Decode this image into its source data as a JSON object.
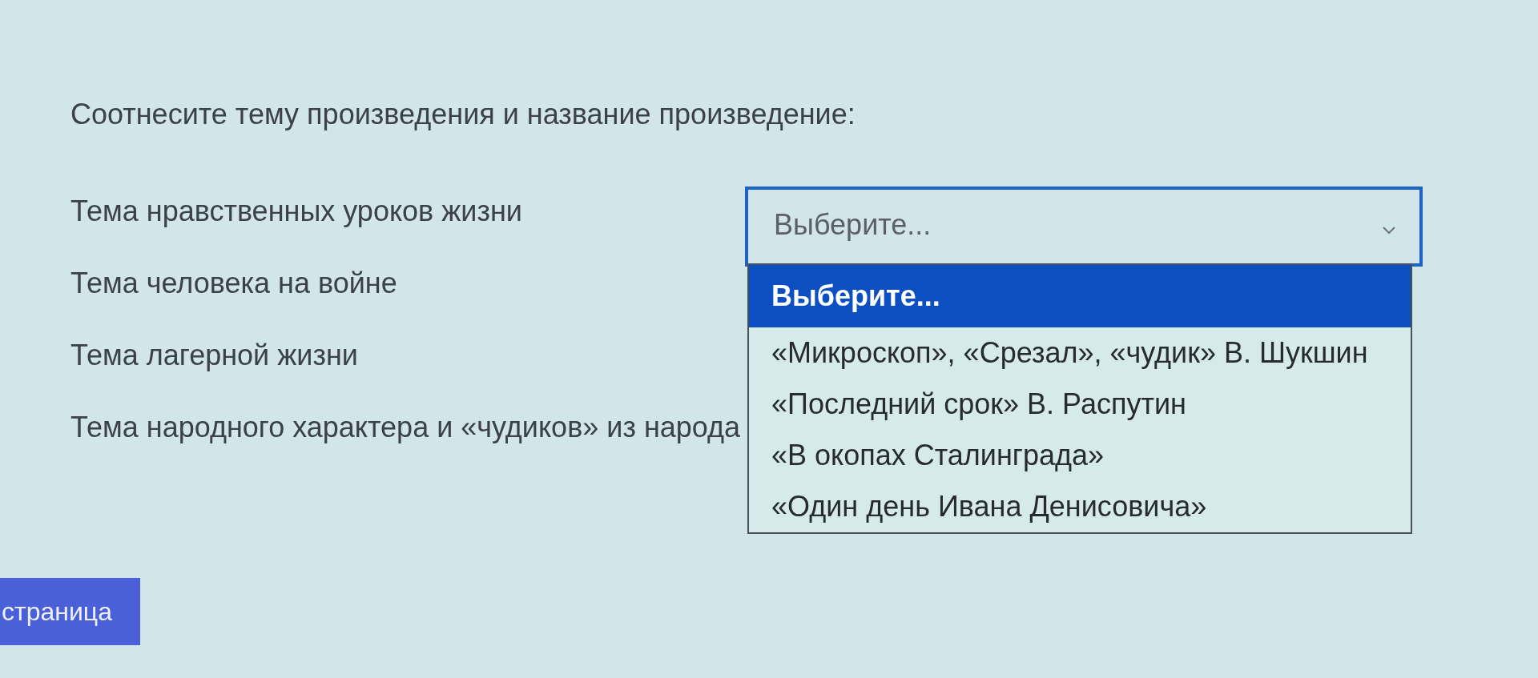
{
  "question": {
    "prompt": "Соотнесите тему произведения и название произведение:"
  },
  "rows": [
    {
      "label": "Тема нравственных уроков жизни",
      "select": {
        "value": "Выберите...",
        "expanded": true,
        "options": [
          {
            "label": "Выберите...",
            "selected": true
          },
          {
            "label": "«Микроскоп», «Срезал», «чудик» В. Шукшин",
            "selected": false
          },
          {
            "label": "«Последний срок» В. Распутин",
            "selected": false
          },
          {
            "label": "«В окопах Сталинграда»",
            "selected": false
          },
          {
            "label": "«Один день Ивана Денисовича»",
            "selected": false
          }
        ]
      }
    },
    {
      "label": "Тема человека на войне"
    },
    {
      "label": "Тема лагерной жизни"
    },
    {
      "label": "Тема народного характера и «чудиков» из народа"
    }
  ],
  "nav_button": {
    "label": "страница"
  }
}
